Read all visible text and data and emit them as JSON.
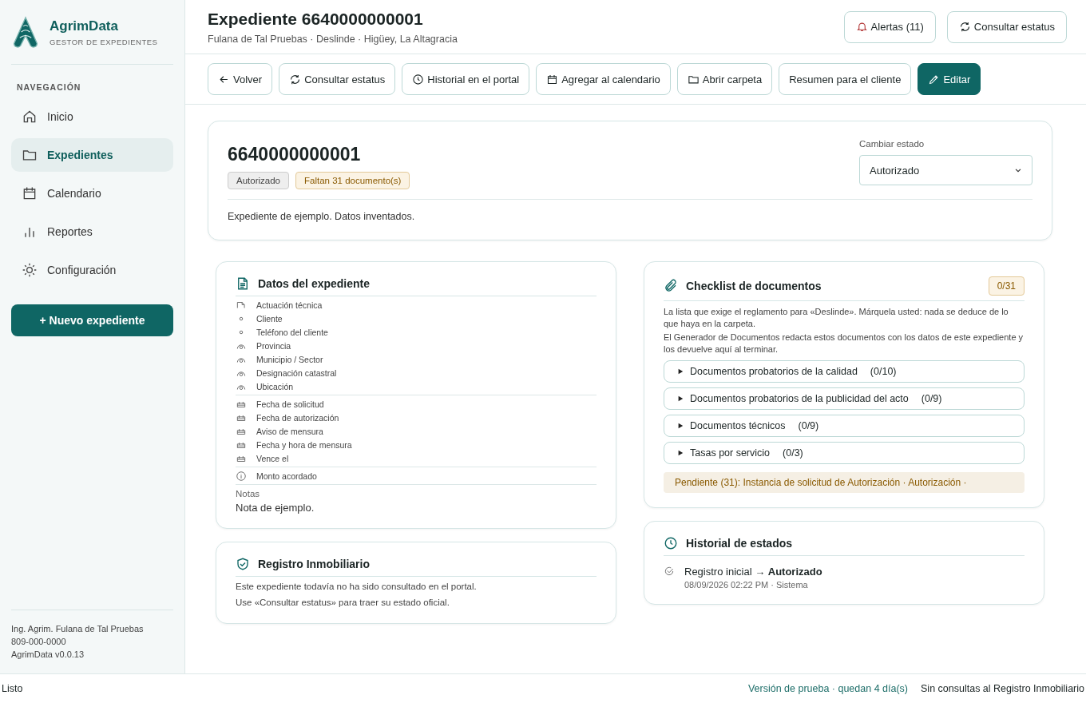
{
  "brand": {
    "name": "AgrimData",
    "tagline": "GESTOR DE EXPEDIENTES"
  },
  "nav": {
    "heading": "NAVEGACIÓN",
    "items": [
      {
        "label": "Inicio",
        "selected": false
      },
      {
        "label": "Expedientes",
        "selected": true
      },
      {
        "label": "Calendario",
        "selected": false
      },
      {
        "label": "Reportes",
        "selected": false
      },
      {
        "label": "Configuración",
        "selected": false
      }
    ]
  },
  "new_button": {
    "icon": "+",
    "label": "Nuevo expediente"
  },
  "user": [
    "Ing. Agrim. Fulana de Tal Pruebas",
    "809-000-0000",
    "AgrimData v0.0.13"
  ],
  "header": {
    "title": "Expediente 6640000000001",
    "subtitle": "Fulana de Tal Pruebas · Deslinde · Higüey, La Altagracia",
    "actions": [
      "Alertas (11)",
      "Consultar estatus"
    ]
  },
  "toolbar": [
    {
      "label": "Volver",
      "primary": false
    },
    {
      "label": "Consultar estatus",
      "primary": false
    },
    {
      "label": "Historial en el portal",
      "primary": false
    },
    {
      "label": "Agregar al calendario",
      "primary": false
    },
    {
      "label": "Abrir carpeta",
      "primary": false
    },
    {
      "label": "Resumen para el cliente",
      "primary": false
    },
    {
      "label": "Editar",
      "primary": true
    }
  ],
  "summary": {
    "number": "6640000000001",
    "badges": [
      {
        "label": "Autorizado",
        "kind": "neutral"
      },
      {
        "label": "Faltan 31 documento(s)",
        "kind": "warning"
      }
    ],
    "state_label": "Cambiar estado",
    "state_value": "Autorizado",
    "description": "Expediente de ejemplo. Datos inventados."
  },
  "datos": {
    "title": "Datos del expediente",
    "groups": [
      [
        "Actuación técnica",
        "Cliente",
        "Teléfono del cliente",
        "Provincia",
        "Municipio / Sector",
        "Designación catastral",
        "Ubicación"
      ],
      [
        "Fecha de solicitud",
        "Fecha de autorización",
        "Aviso de mensura",
        "Fecha y hora de mensura",
        "Vence el"
      ],
      [
        "Monto acordado"
      ]
    ],
    "notes_label": "Notas",
    "notes": "Nota de ejemplo."
  },
  "registro": {
    "title": "Registro Inmobiliario",
    "lines": [
      "Este expediente todavía no ha sido consultado en el portal.",
      "Use «Consultar estatus» para traer su estado oficial."
    ]
  },
  "checklist": {
    "title": "Checklist de documentos",
    "count": "0/31",
    "intro": [
      "La lista que exige el reglamento para «Deslinde». Márquela usted: nada se deduce de lo que haya en la carpeta.",
      "El Generador de Documentos redacta estos documentos con los datos de este expediente y los devuelve aquí al terminar."
    ],
    "groups": [
      {
        "label": "Documentos probatorios de la calidad",
        "count": "(0/10)",
        "expanded": false
      },
      {
        "label": "Documentos probatorios de la publicidad del acto",
        "count": "(0/9)",
        "expanded": false
      },
      {
        "label": "Documentos técnicos",
        "count": "(0/9)",
        "expanded": false
      },
      {
        "label": "Tasas por servicio",
        "count": "(0/3)",
        "expanded": false
      }
    ],
    "pending": "Pendiente (31): Instancia de solicitud de Autorización · Autorización ·"
  },
  "historial": {
    "title": "Historial de estados",
    "entries": [
      {
        "text": "Registro inicial → **Autorizado**",
        "meta": "08/09/2026 02:22 PM · Sistema"
      }
    ]
  },
  "status_bar": {
    "left": "Listo",
    "trial": "Versión de prueba · quedan 4 día(s)",
    "right": "Sin consultas al Registro Inmobiliario"
  }
}
